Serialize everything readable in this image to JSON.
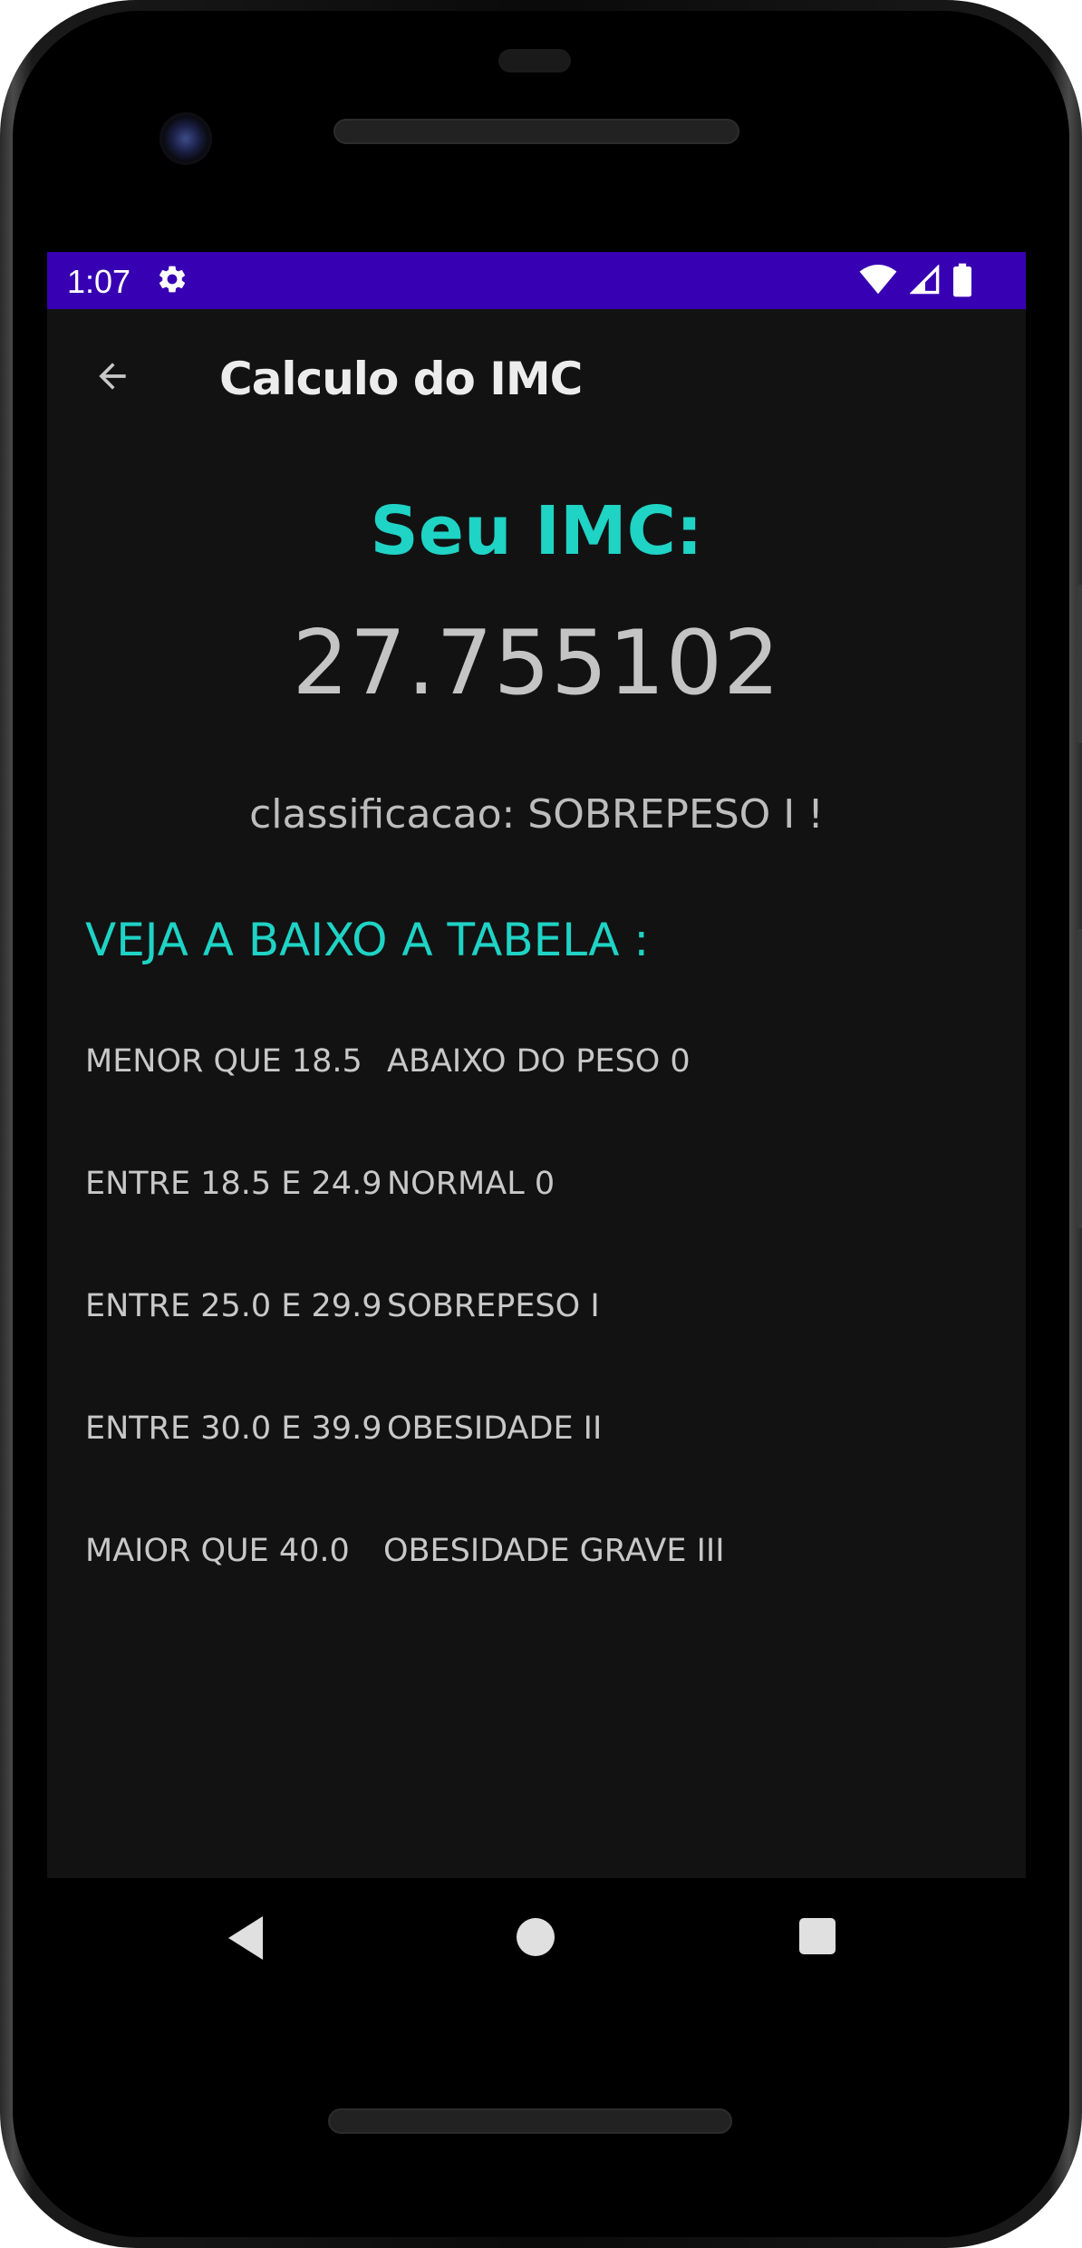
{
  "status_bar": {
    "time": "1:07",
    "icons": [
      "gear-icon",
      "wifi-icon",
      "signal-icon",
      "battery-icon"
    ],
    "color": "#3700b3"
  },
  "app_bar": {
    "title": "Calculo do IMC",
    "back_icon": "arrow-back-icon"
  },
  "result": {
    "heading": "Seu IMC:",
    "value": "27.755102",
    "classification": "classificacao: SOBREPESO I !"
  },
  "table": {
    "title": "VEJA A BAIXO A TABELA :",
    "rows": [
      {
        "range": "MENOR QUE 18.5",
        "label": "ABAIXO DO PESO 0"
      },
      {
        "range": "ENTRE 18.5 E 24.9",
        "label": "NORMAL 0"
      },
      {
        "range": "ENTRE 25.0 E 29.9",
        "label": "SOBREPESO I"
      },
      {
        "range": "ENTRE 30.0 E 39.9",
        "label": "OBESIDADE II"
      },
      {
        "range": "MAIOR QUE 40.0",
        "label": "OBESIDADE GRAVE III"
      }
    ]
  },
  "nav_bar": {
    "buttons": [
      "nav-back-icon",
      "nav-home-icon",
      "nav-recents-icon"
    ]
  },
  "colors": {
    "accent": "#1fd3c5",
    "background": "#121212",
    "status_bar": "#3700b3"
  }
}
